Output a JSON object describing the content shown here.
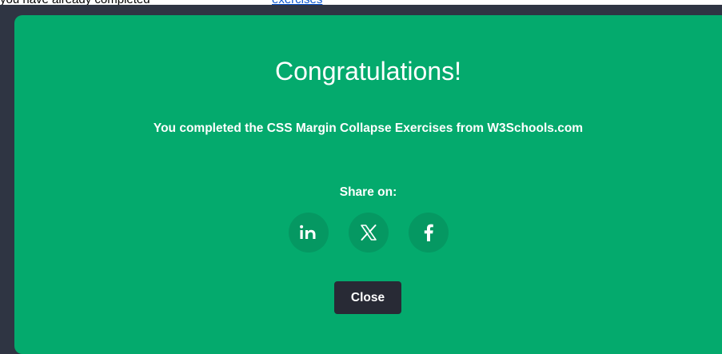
{
  "page": {
    "top_text": "y... ...a ...y ... ...p... ...",
    "top_link": "..."
  },
  "modal": {
    "title": "Congratulations!",
    "message": "You completed the CSS Margin Collapse Exercises from W3Schools.com",
    "share_label": "Share on:",
    "share_buttons": [
      {
        "name": "linkedin",
        "icon": "linkedin-icon"
      },
      {
        "name": "x",
        "icon": "x-icon"
      },
      {
        "name": "facebook",
        "icon": "facebook-icon"
      }
    ],
    "close_label": "Close"
  },
  "colors": {
    "modal_background": "#04aa6d",
    "share_button": "#059862",
    "overlay": "#2f3543",
    "close_button": "#282a35",
    "text": "#ffffff"
  }
}
